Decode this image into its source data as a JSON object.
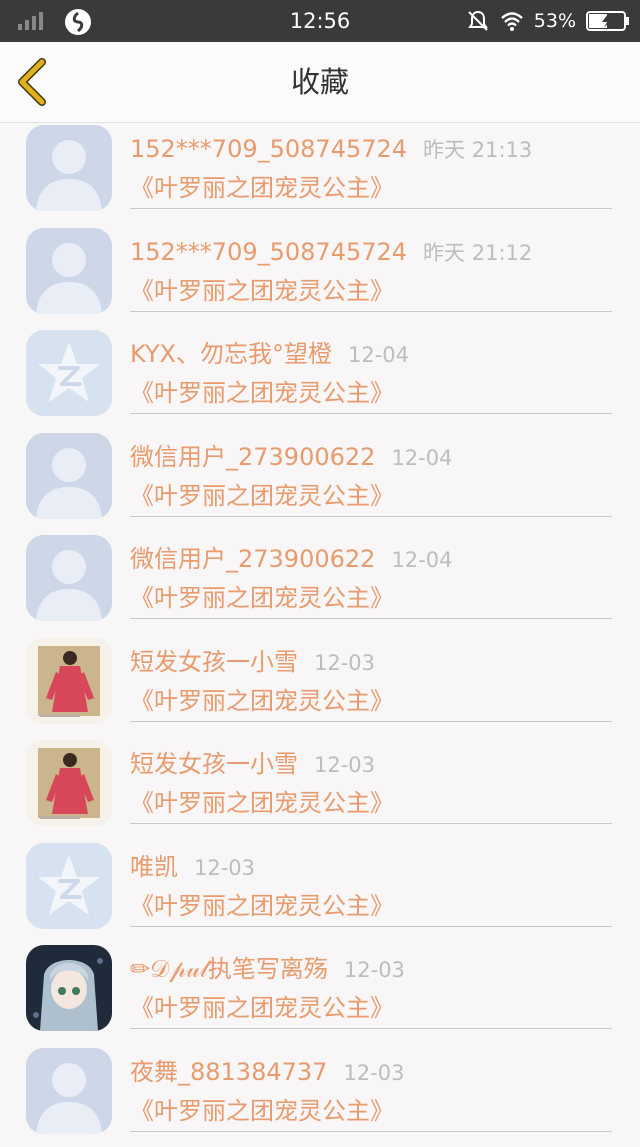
{
  "status_bar": {
    "time": "12:56",
    "battery": "53%",
    "icons": [
      "signal-icon",
      "app-icon",
      "bell-muted-icon",
      "wifi-icon",
      "battery-charging-icon"
    ]
  },
  "header": {
    "title": "收藏",
    "back_icon": "chevron-left-icon",
    "accent_color": "#e0b21e"
  },
  "colors": {
    "name": "#e89b6d",
    "time": "#bdbdbd",
    "background": "#f8f6f7"
  },
  "items": [
    {
      "name": "152***709_508745724",
      "time": "昨天 21:13",
      "subtitle": "《叶罗丽之团宠灵公主》",
      "avatar": "default-person"
    },
    {
      "name": "152***709_508745724",
      "time": "昨天 21:12",
      "subtitle": "《叶罗丽之团宠灵公主》",
      "avatar": "default-person"
    },
    {
      "name": "KYX、勿忘我°望橙",
      "time": "12-04",
      "subtitle": "《叶罗丽之团宠灵公主》",
      "avatar": "qq-star"
    },
    {
      "name": "微信用户_273900622",
      "time": "12-04",
      "subtitle": "《叶罗丽之团宠灵公主》",
      "avatar": "default-person"
    },
    {
      "name": "微信用户_273900622",
      "time": "12-04",
      "subtitle": "《叶罗丽之团宠灵公主》",
      "avatar": "default-person"
    },
    {
      "name": "短发女孩一小雪",
      "time": "12-03",
      "subtitle": "《叶罗丽之团宠灵公主》",
      "avatar": "photo-red-dress"
    },
    {
      "name": "短发女孩一小雪",
      "time": "12-03",
      "subtitle": "《叶罗丽之团宠灵公主》",
      "avatar": "photo-red-dress"
    },
    {
      "name": "唯凯",
      "time": "12-03",
      "subtitle": "《叶罗丽之团宠灵公主》",
      "avatar": "qq-star"
    },
    {
      "name": "✏𝒟𝓅𝓊𝓁执笔写离殇",
      "time": "12-03",
      "subtitle": "《叶罗丽之团宠灵公主》",
      "avatar": "anime-girl"
    },
    {
      "name": "夜舞_881384737",
      "time": "12-03",
      "subtitle": "《叶罗丽之团宠灵公主》",
      "avatar": "default-person"
    }
  ]
}
